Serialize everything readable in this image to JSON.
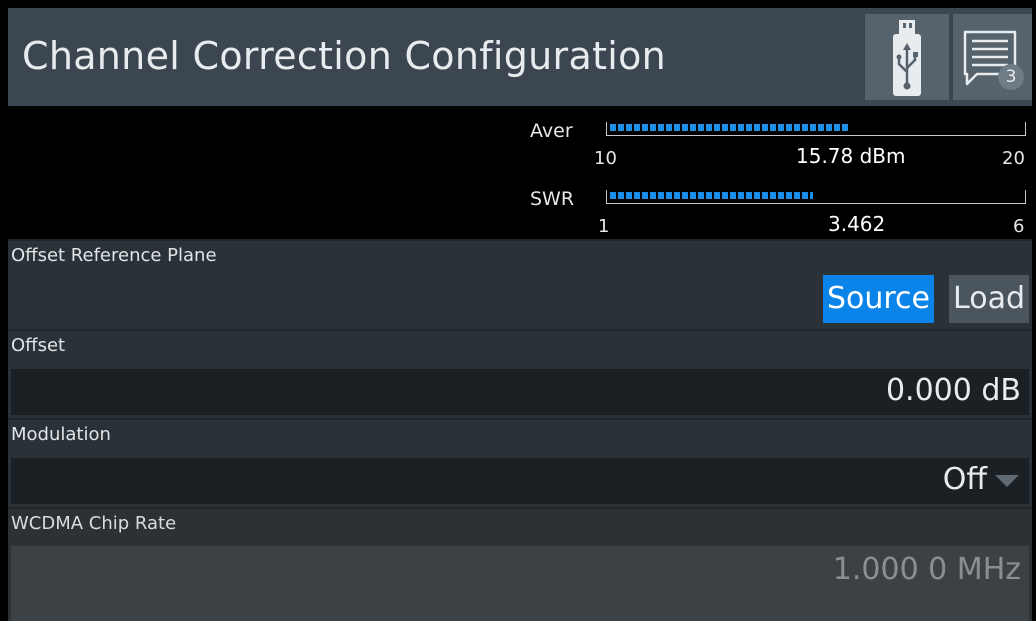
{
  "window": {
    "title": "Channel Correction Configuration"
  },
  "toolbar": {
    "usb_icon": "usb-icon",
    "messages_icon": "message-icon",
    "messages_count": "3"
  },
  "meters": [
    {
      "name": "Aver",
      "min": "10",
      "max": "20",
      "value": "15.78 dBm",
      "level": 0.578
    },
    {
      "name": "SWR",
      "min": "1",
      "max": "6",
      "value": "3.462",
      "level": 0.492
    }
  ],
  "offset_reference_plane": {
    "label": "Offset Reference Plane",
    "options": [
      "Source",
      "Load"
    ],
    "selected": "Source"
  },
  "offset": {
    "label": "Offset",
    "value": "0.000 dB"
  },
  "modulation": {
    "label": "Modulation",
    "value": "Off"
  },
  "wcdma_chip_rate": {
    "label": "WCDMA Chip Rate",
    "value": "1.000 0 MHz"
  },
  "colors": {
    "accent": "#0a84e8",
    "meter_bar": "#1a8fe8",
    "title_bar": "#3b4650"
  }
}
